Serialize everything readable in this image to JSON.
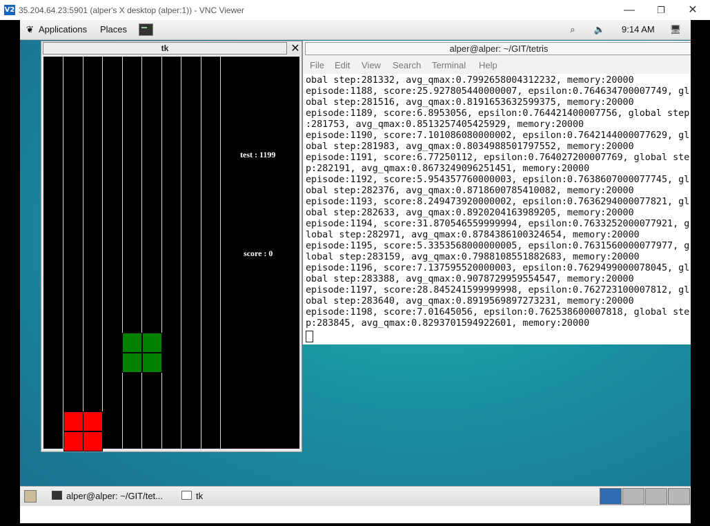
{
  "vnc": {
    "title": "35.204.64.23:5901 (alper's X desktop (alper:1)) - VNC Viewer",
    "logo_text": "V2",
    "minimize": "—",
    "restore": "❐",
    "close": "✕"
  },
  "top_panel": {
    "applications": "Applications",
    "places": "Places",
    "time": "9:14 AM",
    "icons": [
      "gnome-foot-icon",
      "terminal-launcher-icon",
      "network-icon",
      "volume-icon",
      "monitor-icon"
    ]
  },
  "tk_window": {
    "title": "tk",
    "close": "✕",
    "test_label": "test : 1199",
    "score_label": "score : 0",
    "board": {
      "columns": 10,
      "block_colors": {
        "red": "#ff0000",
        "green": "#008000"
      },
      "pieces": [
        {
          "color": "red",
          "cells": [
            [
              1,
              18
            ],
            [
              2,
              18
            ],
            [
              1,
              19
            ],
            [
              2,
              19
            ]
          ]
        },
        {
          "color": "green",
          "cells": [
            [
              4,
              14
            ],
            [
              5,
              14
            ],
            [
              4,
              15
            ],
            [
              5,
              15
            ]
          ]
        }
      ]
    }
  },
  "terminal": {
    "title": "alper@alper: ~/GIT/tetris",
    "menu": [
      "File",
      "Edit",
      "View",
      "Search",
      "Terminal",
      "Help"
    ],
    "lines": [
      "obal step:281332, avg_qmax:0.7992658004312232, memory:20000",
      "episode:1188, score:25.927805440000007, epsilon:0.764634700007749, gl",
      "obal step:281516, avg_qmax:0.8191653632599375, memory:20000",
      "episode:1189, score:6.8953056, epsilon:0.764421400007756, global step",
      ":281753, avg_qmax:0.8513257405425929, memory:20000",
      "episode:1190, score:7.101086080000002, epsilon:0.7642144000077629, gl",
      "obal step:281983, avg_qmax:0.8034988501797552, memory:20000",
      "episode:1191, score:6.77250112, epsilon:0.764027200007769, global ste",
      "p:282191, avg_qmax:0.8673249096251451, memory:20000",
      "episode:1192, score:5.954357760000003, epsilon:0.7638607000077745, gl",
      "obal step:282376, avg_qmax:0.8718600785410082, memory:20000",
      "episode:1193, score:8.249473920000002, epsilon:0.7636294000077821, gl",
      "obal step:282633, avg_qmax:0.8920204163989205, memory:20000",
      "episode:1194, score:31.870546559999994, epsilon:0.7633252000077921, g",
      "lobal step:282971, avg_qmax:0.8784386100324654, memory:20000",
      "episode:1195, score:5.3353568000000005, epsilon:0.7631560000077977, g",
      "lobal step:283159, avg_qmax:0.7988108551882683, memory:20000",
      "episode:1196, score:7.137595520000003, epsilon:0.7629499000078045, gl",
      "obal step:283388, avg_qmax:0.9078729959554547, memory:20000",
      "episode:1197, score:28.845241599999998, epsilon:0.762723100007812, gl",
      "obal step:283640, avg_qmax:0.8919569897273231, memory:20000",
      "episode:1198, score:7.01645056, epsilon:0.762538600007818, global ste",
      "p:283845, avg_qmax:0.8293701594922601, memory:20000"
    ]
  },
  "taskbar": {
    "items": [
      {
        "label": "alper@alper: ~/GIT/tet...",
        "icon": "terminal-icon"
      },
      {
        "label": "tk",
        "icon": "window-icon"
      }
    ]
  }
}
